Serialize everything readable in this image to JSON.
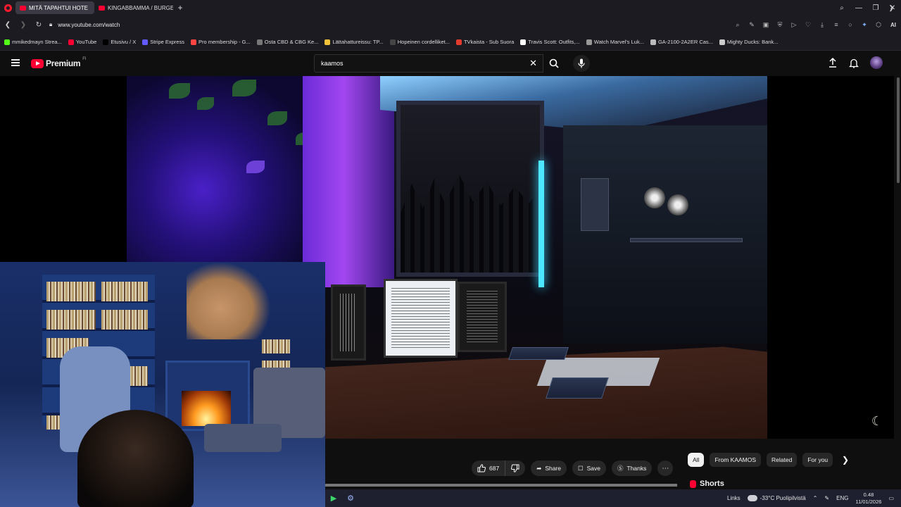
{
  "browser": {
    "tabs": [
      {
        "label": "MITÄ TAPAHTUI HOTE",
        "active": true
      },
      {
        "label": "KINGABBAMMA / BURGE",
        "active": false
      }
    ],
    "url": "www.youtube.com/watch",
    "bookmarks": [
      {
        "label": "mmikedmayn Strea...",
        "color": "#53fc18"
      },
      {
        "label": "YouTube",
        "color": "#ff0033"
      },
      {
        "label": "Etusivu / X",
        "color": "#000000"
      },
      {
        "label": "Stripe Express",
        "color": "#635bff"
      },
      {
        "label": "Pro membership - G...",
        "color": "#ff4444"
      },
      {
        "label": "Osta CBD & CBG Ke...",
        "color": "#777777"
      },
      {
        "label": "Lättahattureissu: TP...",
        "color": "#f2c23a"
      },
      {
        "label": "Hopeinen cordelliket...",
        "color": "#444444"
      },
      {
        "label": "TVkaista - Sub Suora",
        "color": "#e33b2e"
      },
      {
        "label": "Travis Scott: Outfits,...",
        "color": "#ffffff"
      },
      {
        "label": "Watch Marvel's Luk...",
        "color": "#999999"
      },
      {
        "label": "GA-2100-2A2ER Cas...",
        "color": "#bbbbbb"
      },
      {
        "label": "Mighty Ducks: Bank...",
        "color": "#cccccc"
      }
    ],
    "ai_label": "AI"
  },
  "youtube": {
    "logo_text": "Premium",
    "logo_region": "FI",
    "search_value": "kaamos"
  },
  "actions": {
    "like_count": "687",
    "share_label": "Share",
    "save_label": "Save",
    "thanks_label": "Thanks"
  },
  "chips": [
    "All",
    "From KAAMOS",
    "Related",
    "For you"
  ],
  "shorts_label": "Shorts",
  "taskbar": {
    "links_label": "Links",
    "weather": "-33°C Puolipilvistä",
    "language": "ENG",
    "time": "0.48",
    "date": "11/01/2026"
  },
  "colors": {
    "brand": "#ff0033",
    "background": "#0f0f0f"
  }
}
